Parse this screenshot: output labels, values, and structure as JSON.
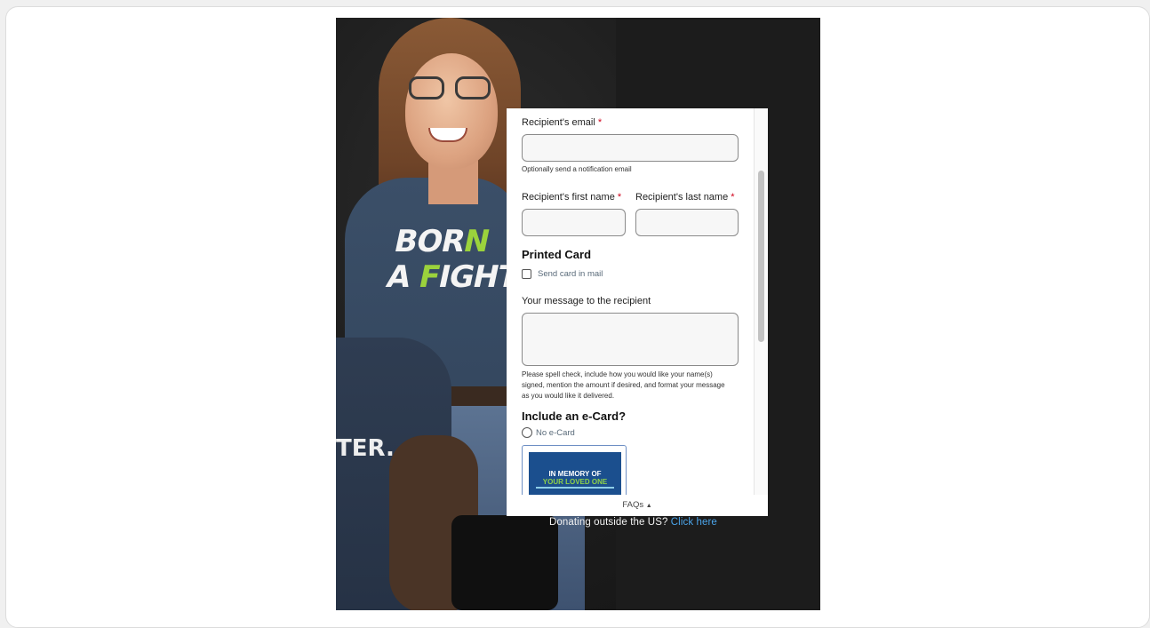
{
  "hero": {
    "shirt_line1_a": "BOR",
    "shirt_line1_b": "N",
    "shirt_line2_a": "A ",
    "shirt_line2_b": "F",
    "shirt_line2_c": "IGHTER.",
    "second_shirt": "TER."
  },
  "form": {
    "recipient_email": {
      "label": "Recipient's email ",
      "required": "*",
      "hint": "Optionally send a notification email",
      "value": ""
    },
    "first_name": {
      "label": "Recipient's first name ",
      "required": "*",
      "value": ""
    },
    "last_name": {
      "label": "Recipient's last name ",
      "required": "*",
      "value": ""
    },
    "printed_card": {
      "heading": "Printed Card",
      "checkbox_label": "Send card in mail",
      "checked": false
    },
    "message": {
      "label": "Your message to the recipient",
      "value": "",
      "hint": "Please spell check, include how you would like your name(s) signed, mention the amount if desired, and format your message as you would like it delivered."
    },
    "ecard": {
      "heading": "Include an e-Card?",
      "no_ecard_label": "No e-Card",
      "card_line1": "IN MEMORY OF",
      "card_line2": "YOUR LOVED ONE"
    }
  },
  "faq": {
    "label": "FAQs",
    "caret": "▲"
  },
  "footer": {
    "text": "Donating outside the US? ",
    "link": "Click here"
  },
  "colors": {
    "required": "#d0021b",
    "link": "#4aa3e8",
    "ecard_bg": "#1b4f8e",
    "ecard_accent": "#8ed14a"
  }
}
